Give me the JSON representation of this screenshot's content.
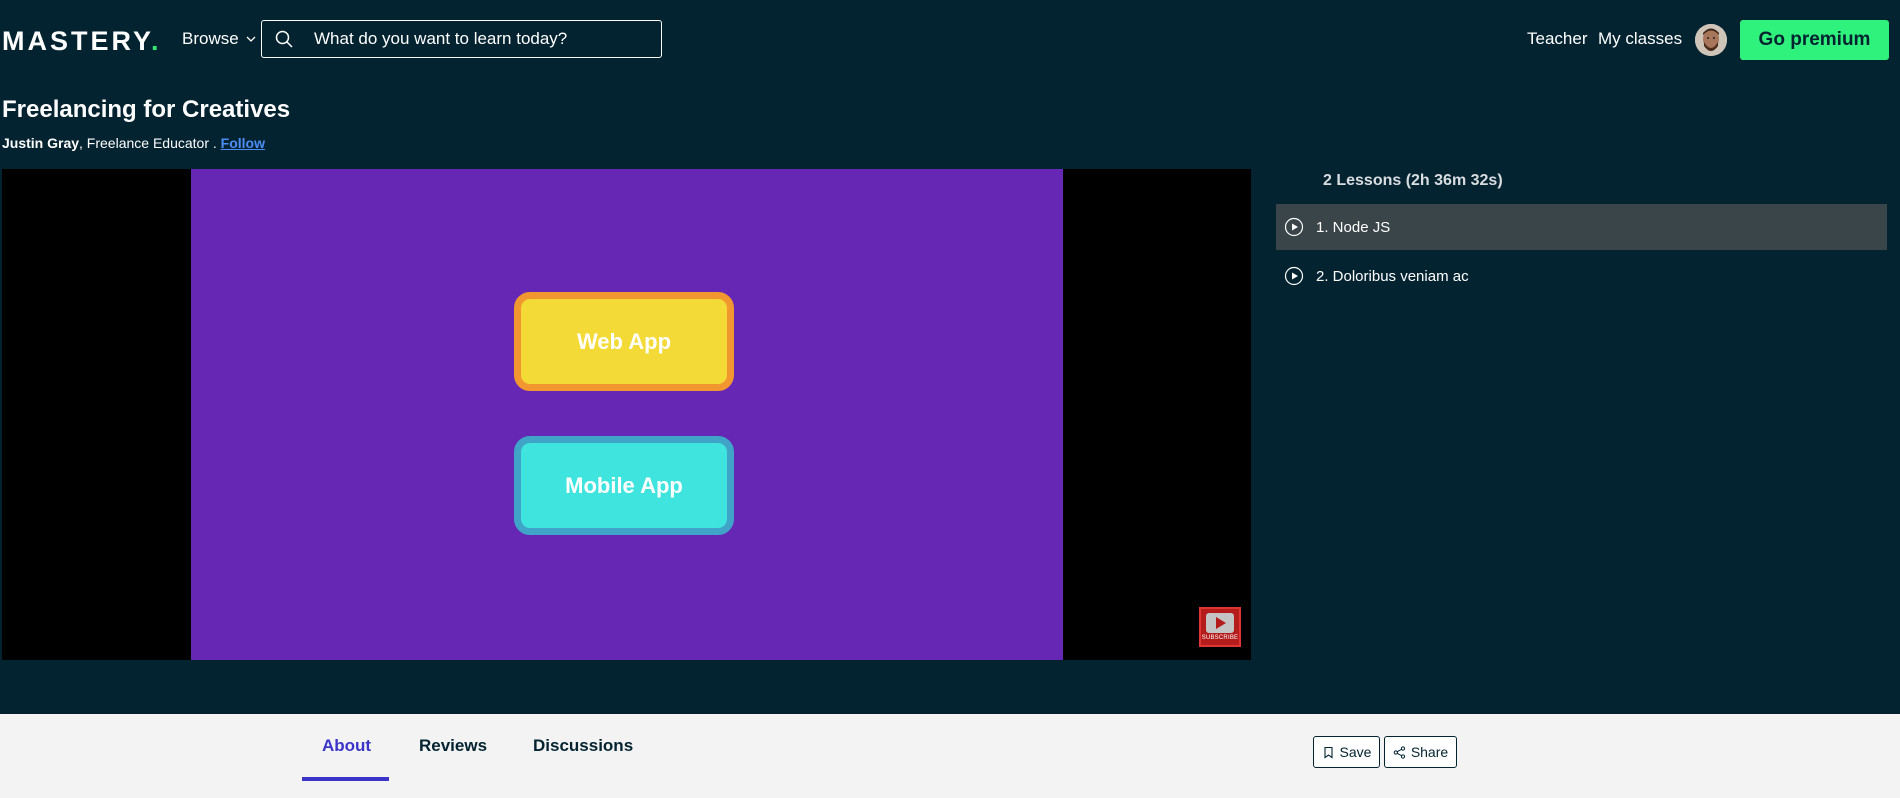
{
  "header": {
    "logo_text": "MASTERY",
    "logo_dot": ".",
    "browse_label": "Browse",
    "search_placeholder": "What do you want to learn today?",
    "teacher_label": "Teacher",
    "my_classes_label": "My classes",
    "premium_label": "Go premium"
  },
  "course": {
    "title": "Freelancing for Creatives",
    "author": "Justin Gray",
    "author_role": ", Freelance Educator . ",
    "follow_label": "Follow"
  },
  "video": {
    "pill_web": "Web App",
    "pill_mobile": "Mobile App",
    "subscribe_text": "SUBSCRIBE"
  },
  "lessons": {
    "heading": "2 Lessons (2h 36m 32s)",
    "items": [
      {
        "label": "1. Node JS"
      },
      {
        "label": "2. Doloribus veniam ac"
      }
    ]
  },
  "tabs": [
    {
      "label": "About"
    },
    {
      "label": "Reviews"
    },
    {
      "label": "Discussions"
    }
  ],
  "actions": {
    "save_label": "Save",
    "share_label": "Share"
  }
}
